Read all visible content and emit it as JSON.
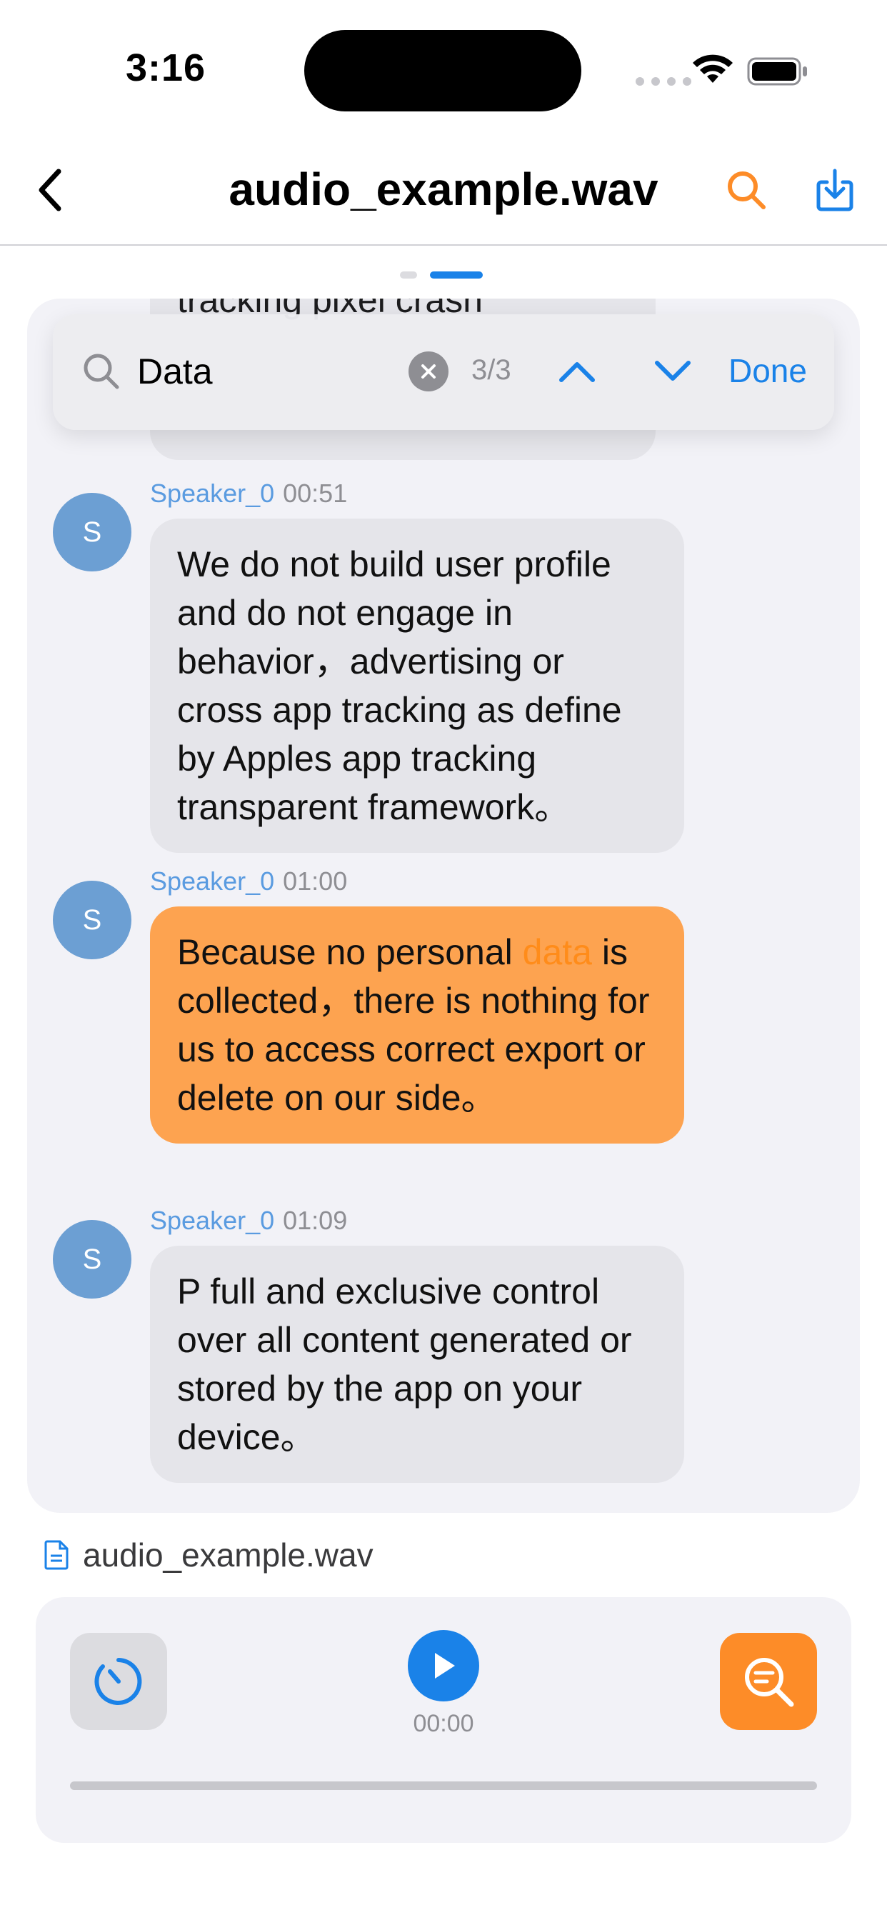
{
  "status": {
    "time": "3:16"
  },
  "nav": {
    "title": "audio_example.wav"
  },
  "transcript": {
    "previous_fragment": "tracking pixel crash",
    "messages": [
      {
        "avatar": "S",
        "speaker": "Speaker_0",
        "time": "00:51",
        "text": "We do not build user profile and do not engage in behavior，advertising or cross app tracking as define by Apples app tracking transparent framework。"
      },
      {
        "avatar": "S",
        "speaker": "Speaker_0",
        "time": "01:00",
        "text_before": "Because no personal ",
        "text_highlight": "data",
        "text_after": " is collected，there is nothing for us to access correct export or delete on our side。"
      },
      {
        "avatar": "S",
        "speaker": "Speaker_0",
        "time": "01:09",
        "text": "P full and exclusive control over all content generated or stored by the app on your device。"
      }
    ]
  },
  "search": {
    "query": "Data",
    "count": "3/3",
    "done_label": "Done"
  },
  "file": {
    "name": "audio_example.wav"
  },
  "player": {
    "time": "00:00",
    "progress": 0
  },
  "colors": {
    "accent_blue": "#1a82e8",
    "accent_orange": "#fd8c28",
    "highlight_bubble": "#fda350"
  }
}
